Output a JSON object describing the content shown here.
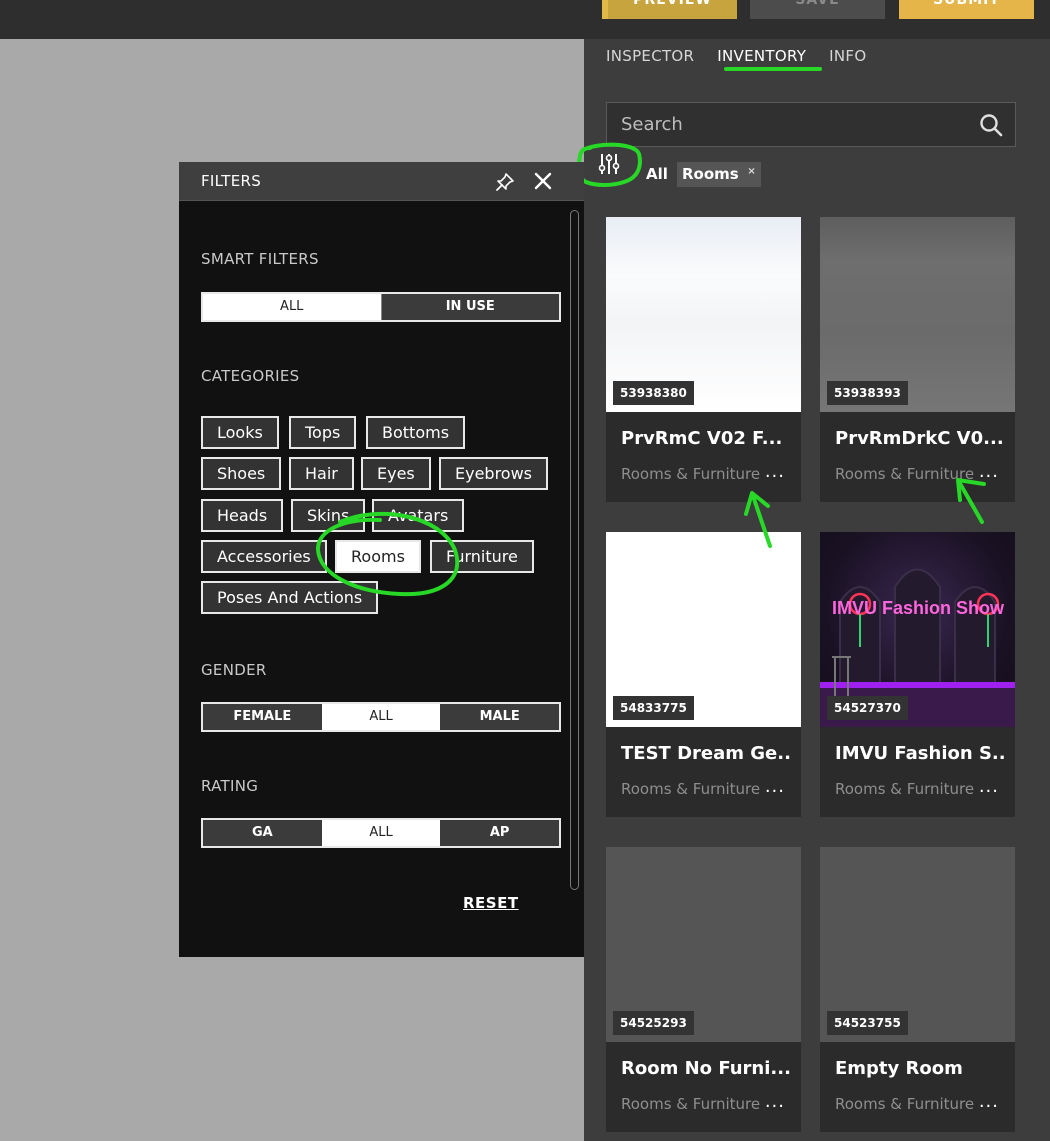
{
  "topbar": {
    "preview_label": "PREVIEW",
    "save_label": "SAVE",
    "submit_label": "SUBMIT"
  },
  "tabs": [
    {
      "label": "INSPECTOR"
    },
    {
      "label": "INVENTORY"
    },
    {
      "label": "INFO"
    }
  ],
  "search": {
    "placeholder": "Search"
  },
  "active_filters": {
    "all_label": "All",
    "chip_label": "Rooms",
    "chip_close": "×"
  },
  "products": [
    {
      "id": "53938380",
      "title": "PrvRmC V02 F...",
      "category": "Rooms & Furniture"
    },
    {
      "id": "53938393",
      "title": "PrvRmDrkC V0...",
      "category": "Rooms & Furniture"
    },
    {
      "id": "54833775",
      "title": "TEST Dream Ge...",
      "category": "Rooms & Furniture"
    },
    {
      "id": "54527370",
      "title": "IMVU Fashion S...",
      "category": "Rooms & Furniture",
      "art_text": "IMVU Fashion Show"
    },
    {
      "id": "54525293",
      "title": "Room No Furni...",
      "category": "Rooms & Furniture"
    },
    {
      "id": "54523755",
      "title": "Empty Room",
      "category": "Rooms & Furniture"
    }
  ],
  "more_label": "...",
  "filters": {
    "title": "FILTERS",
    "smart_filters_label": "SMART FILTERS",
    "smart_filters": [
      "ALL",
      "IN USE"
    ],
    "categories_label": "CATEGORIES",
    "categories": [
      "Looks",
      "Tops",
      "Bottoms",
      "Shoes",
      "Hair",
      "Eyes",
      "Eyebrows",
      "Heads",
      "Skins",
      "Avatars",
      "Accessories",
      "Rooms",
      "Furniture",
      "Poses And Actions"
    ],
    "selected_category": "Rooms",
    "gender_label": "GENDER",
    "gender": [
      "FEMALE",
      "ALL",
      "MALE"
    ],
    "rating_label": "RATING",
    "rating": [
      "GA",
      "ALL",
      "AP"
    ],
    "reset_label": "RESET"
  },
  "colors": {
    "annotation": "#27d827",
    "preview": "#c8a43e",
    "submit": "#e5b54a"
  }
}
